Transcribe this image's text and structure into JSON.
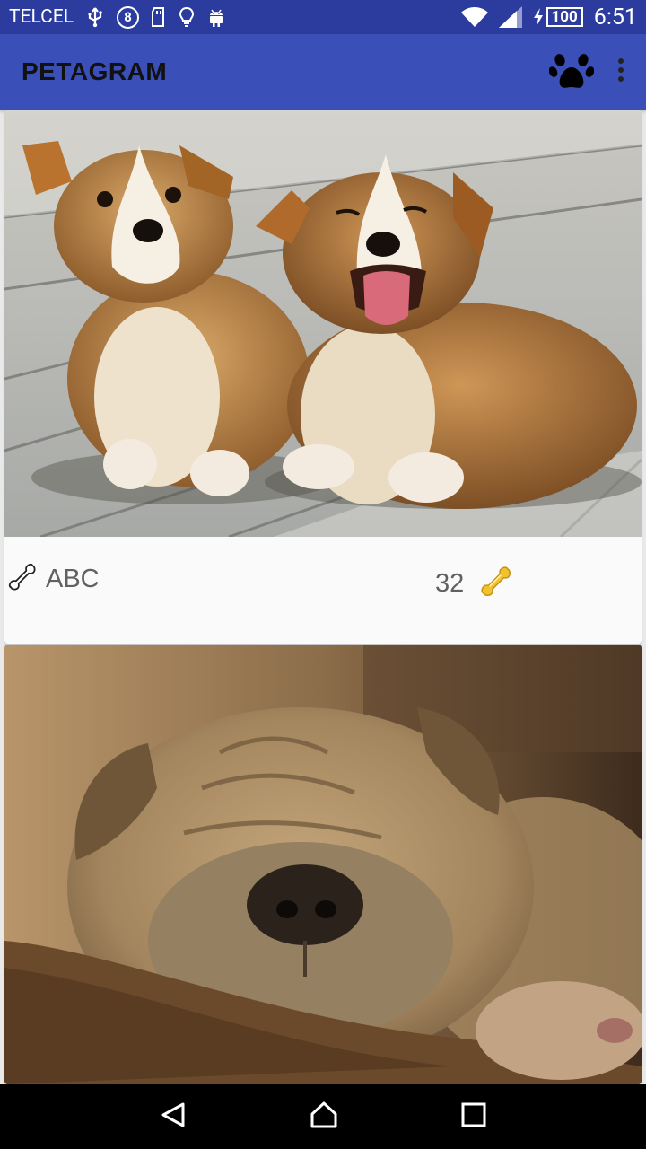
{
  "status_bar": {
    "carrier": "TELCEL",
    "notification_count": "8",
    "battery": "100",
    "time": "6:51"
  },
  "app_bar": {
    "title": "PETAGRAM"
  },
  "pets": [
    {
      "name": "ABC",
      "likes": "32",
      "image": "two corgi puppies on wooden deck"
    },
    {
      "name": "",
      "likes": "",
      "image": "sleeping shar-pei puppy"
    }
  ],
  "colors": {
    "status_bar": "#2c3c9e",
    "app_bar": "#3b4fb8",
    "card_bg": "#fafafa",
    "bone_gold": "#f2c12e"
  }
}
